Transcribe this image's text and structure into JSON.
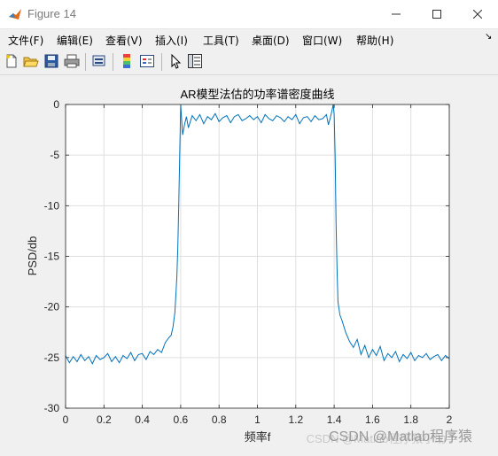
{
  "window": {
    "title": "Figure 14",
    "icon": "matlab-icon"
  },
  "menu": {
    "items": [
      "文件(F)",
      "编辑(E)",
      "查看(V)",
      "插入(I)",
      "工具(T)",
      "桌面(D)",
      "窗口(W)",
      "帮助(H)"
    ],
    "overflow_glyph": "↘"
  },
  "toolbar": {
    "icons": [
      "new-figure-icon",
      "open-file-icon",
      "save-icon",
      "print-icon",
      "link-plot-icon",
      "colorbar-icon",
      "legend-icon",
      "pointer-icon",
      "property-inspector-icon"
    ]
  },
  "watermark": {
    "text": "CSDN @Matlab程序猿",
    "faint_text": "CSDN @Matlab程序猿小助手"
  },
  "chart_data": {
    "type": "line",
    "title": "AR模型法估的功率谱密度曲线",
    "xlabel": "频率f",
    "ylabel": "PSD/db",
    "xlim": [
      0,
      2
    ],
    "ylim": [
      -30,
      0
    ],
    "xticks": [
      "0",
      "0.2",
      "0.4",
      "0.6",
      "0.8",
      "1",
      "1.2",
      "1.4",
      "1.6",
      "1.8",
      "2"
    ],
    "yticks": [
      "0",
      "-5",
      "-10",
      "-15",
      "-20",
      "-25",
      "-30"
    ],
    "grid": true,
    "line_color": "#0072bd",
    "series": [
      {
        "x": [
          0,
          0.02,
          0.04,
          0.06,
          0.08,
          0.1,
          0.12,
          0.14,
          0.16,
          0.18,
          0.2,
          0.22,
          0.24,
          0.26,
          0.28,
          0.3,
          0.32,
          0.34,
          0.36,
          0.38,
          0.4,
          0.42,
          0.44,
          0.46,
          0.48,
          0.5,
          0.52,
          0.54,
          0.55,
          0.56,
          0.57,
          0.58,
          0.585,
          0.59,
          0.595,
          0.6,
          0.605,
          0.61,
          0.62,
          0.63,
          0.64,
          0.66,
          0.68,
          0.7,
          0.72,
          0.74,
          0.76,
          0.78,
          0.8,
          0.82,
          0.84,
          0.86,
          0.88,
          0.9,
          0.92,
          0.94,
          0.96,
          0.98,
          1.0,
          1.02,
          1.04,
          1.06,
          1.08,
          1.1,
          1.12,
          1.14,
          1.16,
          1.18,
          1.2,
          1.22,
          1.24,
          1.26,
          1.28,
          1.3,
          1.32,
          1.34,
          1.36,
          1.37,
          1.38,
          1.39,
          1.395,
          1.4,
          1.405,
          1.41,
          1.415,
          1.42,
          1.43,
          1.44,
          1.46,
          1.48,
          1.5,
          1.52,
          1.54,
          1.56,
          1.58,
          1.6,
          1.62,
          1.64,
          1.66,
          1.68,
          1.7,
          1.72,
          1.74,
          1.76,
          1.78,
          1.8,
          1.82,
          1.84,
          1.86,
          1.88,
          1.9,
          1.92,
          1.94,
          1.96,
          1.98,
          2.0
        ],
        "y": [
          -24.8,
          -25.5,
          -24.9,
          -25.4,
          -24.7,
          -25.3,
          -24.9,
          -25.6,
          -24.8,
          -25.2,
          -25.0,
          -24.6,
          -25.4,
          -24.9,
          -25.5,
          -24.8,
          -25.1,
          -24.5,
          -25.3,
          -24.7,
          -24.6,
          -25.2,
          -24.4,
          -24.7,
          -24.2,
          -24.5,
          -23.5,
          -23.0,
          -22.8,
          -22.0,
          -20.5,
          -17.0,
          -14.0,
          -10.0,
          -5.0,
          0.0,
          -1.5,
          -3.0,
          -2.0,
          -1.2,
          -2.3,
          -1.1,
          -1.6,
          -1.0,
          -1.9,
          -1.2,
          -1.5,
          -0.9,
          -1.7,
          -1.3,
          -1.1,
          -1.8,
          -1.2,
          -1.0,
          -1.6,
          -1.4,
          -1.1,
          -1.5,
          -1.2,
          -1.8,
          -1.0,
          -1.4,
          -1.6,
          -1.1,
          -1.3,
          -1.7,
          -1.2,
          -1.5,
          -1.0,
          -1.9,
          -1.3,
          -1.2,
          -1.7,
          -1.1,
          -1.5,
          -1.4,
          -1.0,
          -2.0,
          -1.3,
          -0.5,
          0.0,
          -1.0,
          -5.0,
          -12.0,
          -16.0,
          -19.5,
          -20.8,
          -21.3,
          -22.5,
          -23.4,
          -24.0,
          -23.2,
          -24.7,
          -23.8,
          -25.0,
          -24.2,
          -24.8,
          -23.9,
          -25.3,
          -24.6,
          -25.0,
          -24.4,
          -25.4,
          -24.7,
          -25.1,
          -24.5,
          -25.3,
          -24.8,
          -25.0,
          -24.6,
          -25.2,
          -24.9,
          -24.7,
          -25.3,
          -24.8,
          -25.1
        ]
      }
    ]
  }
}
